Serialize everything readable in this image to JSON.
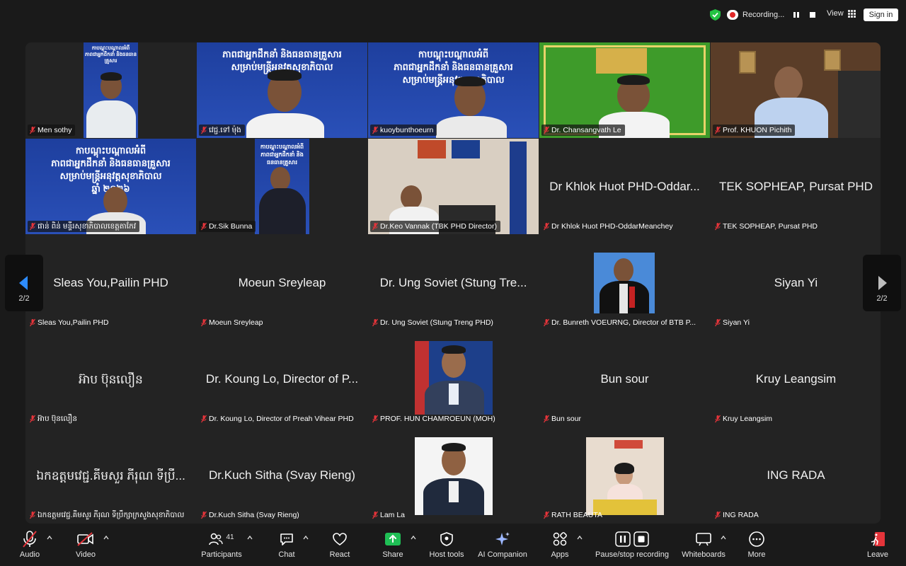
{
  "topbar": {
    "recording_label": "Recording...",
    "view_label": "View",
    "signin_label": "Sign in"
  },
  "grid": {
    "page_indicator_left": "2/2",
    "page_indicator_right": "2/2",
    "tiles": [
      {
        "name": "Men sothy"
      },
      {
        "name": "វេជ្ជ.ទៅ ម៉ុង"
      },
      {
        "name": "kuoybunthoeurn"
      },
      {
        "name": "Dr. Chansangvath Le"
      },
      {
        "name": "Prof. KHUON Pichith"
      },
      {
        "name": "ផាន់ ពិន់ មន្ទីរសុខាភិបាលខេត្តតាកែវ"
      },
      {
        "name": "Dr.Sik Bunna"
      },
      {
        "name": "Dr.Keo Vannak (TBK PHD Director)"
      },
      {
        "name": "Dr Khlok Huot PHD-OddarMeanchey",
        "big": "Dr Khlok Huot PHD-Oddar..."
      },
      {
        "name": "TEK SOPHEAP, Pursat PHD",
        "big": "TEK SOPHEAP, Pursat PHD"
      },
      {
        "name": "Sleas You,Pailin PHD",
        "big": "Sleas You,Pailin PHD"
      },
      {
        "name": "Moeun Sreyleap",
        "big": "Moeun Sreyleap"
      },
      {
        "name": "Dr. Ung Soviet (Stung Treng PHD)",
        "big": "Dr. Ung Soviet (Stung Tre..."
      },
      {
        "name": "Dr. Bunreth VOEURNG, Director of BTB P..."
      },
      {
        "name": "Siyan Yi",
        "big": "Siyan Yi"
      },
      {
        "name": "អ៊ាប ប៊ុនលឿន",
        "big": "អ៊ាប ប៊ុនលឿន"
      },
      {
        "name": "Dr. Koung Lo, Director of Preah Vihear PHD",
        "big": "Dr. Koung Lo, Director of P..."
      },
      {
        "name": "PROF. HUN CHAMROEUN (MOH)"
      },
      {
        "name": "Bun sour",
        "big": "Bun sour"
      },
      {
        "name": "Kruy Leangsim",
        "big": "Kruy Leangsim"
      },
      {
        "name": "ឯកឧត្តមវេជ្ជ.គីមសួរ ភីរុណ ទីប្រឹក្សាក្រសួងសុខាភិបាល",
        "big": "ឯកឧត្តមវេជ្ជ.គីមសួរ ភីរុណ ទីប្រឹ..."
      },
      {
        "name": "Dr.Kuch Sitha (Svay Rieng)",
        "big": "Dr.Kuch Sitha (Svay Rieng)"
      },
      {
        "name": "Lam La"
      },
      {
        "name": "RATH BEAUTA"
      },
      {
        "name": "ING RADA",
        "big": "ING RADA"
      }
    ],
    "banner_text": {
      "line1": "កាបណ្តុះបណ្តាលអំពី",
      "line2": "ភាពជាអ្នកដឹកនាំ និងធនធានគ្រួសារ",
      "line3": "សម្រាប់មន្ត្រីអនុវត្តសុខាភិបាល",
      "line4": "ឆ្នាំ ២០២៦"
    }
  },
  "toolbar": {
    "participants_count": "41",
    "items": {
      "audio": "Audio",
      "video": "Video",
      "participants": "Participants",
      "chat": "Chat",
      "react": "React",
      "share": "Share",
      "host_tools": "Host tools",
      "ai_companion": "AI Companion",
      "apps": "Apps",
      "pause_stop": "Pause/stop recording",
      "whiteboards": "Whiteboards",
      "more": "More",
      "leave": "Leave"
    }
  },
  "colors": {
    "accent_green": "#23c343",
    "share_green": "#1fbf55",
    "leave_red": "#e5343a",
    "banner_blue": "#2147a8",
    "banner_green": "#3e9b2a"
  }
}
